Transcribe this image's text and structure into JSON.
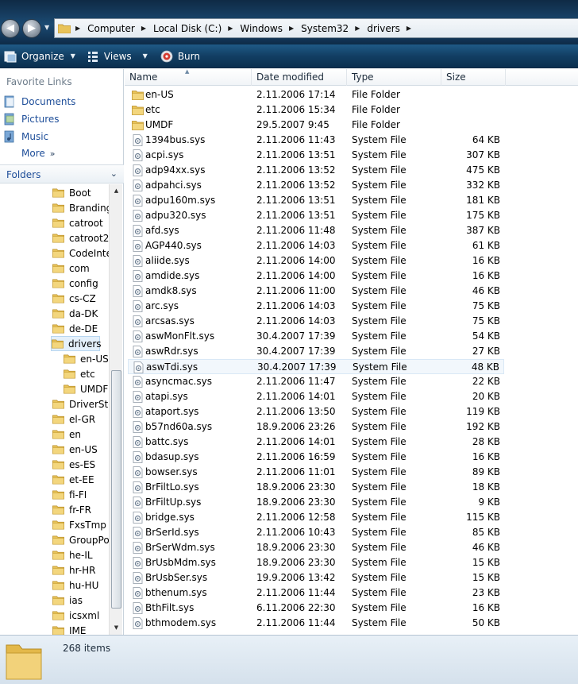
{
  "address": {
    "crumbs": [
      "Computer",
      "Local Disk (C:)",
      "Windows",
      "System32",
      "drivers"
    ]
  },
  "commands": {
    "organize": "Organize",
    "views": "Views",
    "burn": "Burn"
  },
  "favorites": {
    "title": "Favorite Links",
    "items": [
      {
        "label": "Documents",
        "icon": "documents-icon"
      },
      {
        "label": "Pictures",
        "icon": "pictures-icon"
      },
      {
        "label": "Music",
        "icon": "music-icon"
      }
    ],
    "more": "More"
  },
  "folders": {
    "title": "Folders",
    "tree": [
      {
        "label": "Boot",
        "indent": 0
      },
      {
        "label": "Branding",
        "indent": 0
      },
      {
        "label": "catroot",
        "indent": 0
      },
      {
        "label": "catroot2",
        "indent": 0
      },
      {
        "label": "CodeInte",
        "indent": 0
      },
      {
        "label": "com",
        "indent": 0
      },
      {
        "label": "config",
        "indent": 0
      },
      {
        "label": "cs-CZ",
        "indent": 0
      },
      {
        "label": "da-DK",
        "indent": 0
      },
      {
        "label": "de-DE",
        "indent": 0
      },
      {
        "label": "drivers",
        "indent": 0,
        "selected": true
      },
      {
        "label": "en-US",
        "indent": 1
      },
      {
        "label": "etc",
        "indent": 1
      },
      {
        "label": "UMDF",
        "indent": 1
      },
      {
        "label": "DriverSto",
        "indent": 0
      },
      {
        "label": "el-GR",
        "indent": 0
      },
      {
        "label": "en",
        "indent": 0
      },
      {
        "label": "en-US",
        "indent": 0
      },
      {
        "label": "es-ES",
        "indent": 0
      },
      {
        "label": "et-EE",
        "indent": 0
      },
      {
        "label": "fi-FI",
        "indent": 0
      },
      {
        "label": "fr-FR",
        "indent": 0
      },
      {
        "label": "FxsTmp",
        "indent": 0
      },
      {
        "label": "GroupPo",
        "indent": 0
      },
      {
        "label": "he-IL",
        "indent": 0
      },
      {
        "label": "hr-HR",
        "indent": 0
      },
      {
        "label": "hu-HU",
        "indent": 0
      },
      {
        "label": "ias",
        "indent": 0
      },
      {
        "label": "icsxml",
        "indent": 0
      },
      {
        "label": "IME",
        "indent": 0
      }
    ]
  },
  "columns": {
    "name": "Name",
    "date": "Date modified",
    "type": "Type",
    "size": "Size"
  },
  "files": [
    {
      "name": "en-US",
      "date": "2.11.2006 17:14",
      "type": "File Folder",
      "size": "",
      "kind": "folder"
    },
    {
      "name": "etc",
      "date": "2.11.2006 15:34",
      "type": "File Folder",
      "size": "",
      "kind": "folder"
    },
    {
      "name": "UMDF",
      "date": "29.5.2007 9:45",
      "type": "File Folder",
      "size": "",
      "kind": "folder"
    },
    {
      "name": "1394bus.sys",
      "date": "2.11.2006 11:43",
      "type": "System File",
      "size": "64 KB",
      "kind": "sys"
    },
    {
      "name": "acpi.sys",
      "date": "2.11.2006 13:51",
      "type": "System File",
      "size": "307 KB",
      "kind": "sys"
    },
    {
      "name": "adp94xx.sys",
      "date": "2.11.2006 13:52",
      "type": "System File",
      "size": "475 KB",
      "kind": "sys"
    },
    {
      "name": "adpahci.sys",
      "date": "2.11.2006 13:52",
      "type": "System File",
      "size": "332 KB",
      "kind": "sys"
    },
    {
      "name": "adpu160m.sys",
      "date": "2.11.2006 13:51",
      "type": "System File",
      "size": "181 KB",
      "kind": "sys"
    },
    {
      "name": "adpu320.sys",
      "date": "2.11.2006 13:51",
      "type": "System File",
      "size": "175 KB",
      "kind": "sys"
    },
    {
      "name": "afd.sys",
      "date": "2.11.2006 11:48",
      "type": "System File",
      "size": "387 KB",
      "kind": "sys"
    },
    {
      "name": "AGP440.sys",
      "date": "2.11.2006 14:03",
      "type": "System File",
      "size": "61 KB",
      "kind": "sys"
    },
    {
      "name": "aliide.sys",
      "date": "2.11.2006 14:00",
      "type": "System File",
      "size": "16 KB",
      "kind": "sys"
    },
    {
      "name": "amdide.sys",
      "date": "2.11.2006 14:00",
      "type": "System File",
      "size": "16 KB",
      "kind": "sys"
    },
    {
      "name": "amdk8.sys",
      "date": "2.11.2006 11:00",
      "type": "System File",
      "size": "46 KB",
      "kind": "sys"
    },
    {
      "name": "arc.sys",
      "date": "2.11.2006 14:03",
      "type": "System File",
      "size": "75 KB",
      "kind": "sys"
    },
    {
      "name": "arcsas.sys",
      "date": "2.11.2006 14:03",
      "type": "System File",
      "size": "75 KB",
      "kind": "sys"
    },
    {
      "name": "aswMonFlt.sys",
      "date": "30.4.2007 17:39",
      "type": "System File",
      "size": "54 KB",
      "kind": "sys"
    },
    {
      "name": "aswRdr.sys",
      "date": "30.4.2007 17:39",
      "type": "System File",
      "size": "27 KB",
      "kind": "sys"
    },
    {
      "name": "aswTdi.sys",
      "date": "30.4.2007 17:39",
      "type": "System File",
      "size": "48 KB",
      "kind": "sys",
      "hover": true
    },
    {
      "name": "asyncmac.sys",
      "date": "2.11.2006 11:47",
      "type": "System File",
      "size": "22 KB",
      "kind": "sys"
    },
    {
      "name": "atapi.sys",
      "date": "2.11.2006 14:01",
      "type": "System File",
      "size": "20 KB",
      "kind": "sys"
    },
    {
      "name": "ataport.sys",
      "date": "2.11.2006 13:50",
      "type": "System File",
      "size": "119 KB",
      "kind": "sys"
    },
    {
      "name": "b57nd60a.sys",
      "date": "18.9.2006 23:26",
      "type": "System File",
      "size": "192 KB",
      "kind": "sys"
    },
    {
      "name": "battc.sys",
      "date": "2.11.2006 14:01",
      "type": "System File",
      "size": "28 KB",
      "kind": "sys"
    },
    {
      "name": "bdasup.sys",
      "date": "2.11.2006 16:59",
      "type": "System File",
      "size": "16 KB",
      "kind": "sys"
    },
    {
      "name": "bowser.sys",
      "date": "2.11.2006 11:01",
      "type": "System File",
      "size": "89 KB",
      "kind": "sys"
    },
    {
      "name": "BrFiltLo.sys",
      "date": "18.9.2006 23:30",
      "type": "System File",
      "size": "18 KB",
      "kind": "sys"
    },
    {
      "name": "BrFiltUp.sys",
      "date": "18.9.2006 23:30",
      "type": "System File",
      "size": "9 KB",
      "kind": "sys"
    },
    {
      "name": "bridge.sys",
      "date": "2.11.2006 12:58",
      "type": "System File",
      "size": "115 KB",
      "kind": "sys"
    },
    {
      "name": "BrSerId.sys",
      "date": "2.11.2006 10:43",
      "type": "System File",
      "size": "85 KB",
      "kind": "sys"
    },
    {
      "name": "BrSerWdm.sys",
      "date": "18.9.2006 23:30",
      "type": "System File",
      "size": "46 KB",
      "kind": "sys"
    },
    {
      "name": "BrUsbMdm.sys",
      "date": "18.9.2006 23:30",
      "type": "System File",
      "size": "15 KB",
      "kind": "sys"
    },
    {
      "name": "BrUsbSer.sys",
      "date": "19.9.2006 13:42",
      "type": "System File",
      "size": "15 KB",
      "kind": "sys"
    },
    {
      "name": "bthenum.sys",
      "date": "2.11.2006 11:44",
      "type": "System File",
      "size": "23 KB",
      "kind": "sys"
    },
    {
      "name": "BthFilt.sys",
      "date": "6.11.2006 22:30",
      "type": "System File",
      "size": "16 KB",
      "kind": "sys"
    },
    {
      "name": "bthmodem.sys",
      "date": "2.11.2006 11:44",
      "type": "System File",
      "size": "50 KB",
      "kind": "sys"
    }
  ],
  "status": {
    "count": "268 items"
  },
  "colors": {
    "link": "#1e4e99",
    "folder": "#e8c35a",
    "toolbar": "#123e63"
  }
}
